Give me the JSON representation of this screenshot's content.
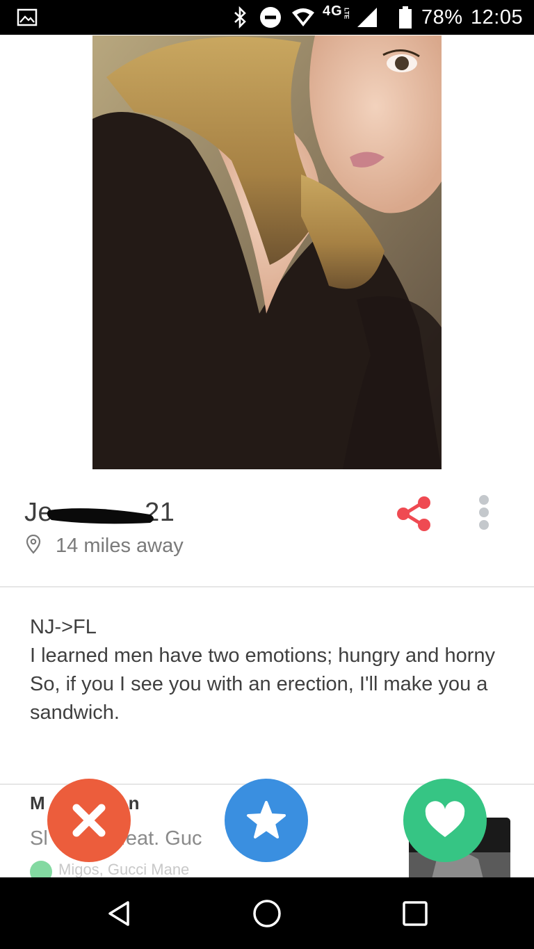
{
  "status_bar": {
    "network": "4G",
    "network_sub": "LTE",
    "battery": "78%",
    "time": "12:05"
  },
  "profile": {
    "name_visible": "Je",
    "age": "21",
    "distance": "14 miles away",
    "bio": "NJ->FL\nI learned men have two emotions; hungry and horny\nSo, if you I see you with an erection, I'll make you a sandwich."
  },
  "music": {
    "title_partial_left": "M",
    "title_partial_right": "n",
    "song_partial_left": "Sl",
    "song_partial_mid": "feat. Guc",
    "song_partial_right": ")",
    "artist": "Migos, Gucci Mane"
  },
  "actions": {
    "nope_icon": "close-icon",
    "superlike_icon": "star-icon",
    "like_icon": "heart-icon"
  },
  "colors": {
    "nope": "#ec5d3c",
    "superlike": "#3a8fe0",
    "like": "#36c584",
    "share": "#ef4a52"
  }
}
